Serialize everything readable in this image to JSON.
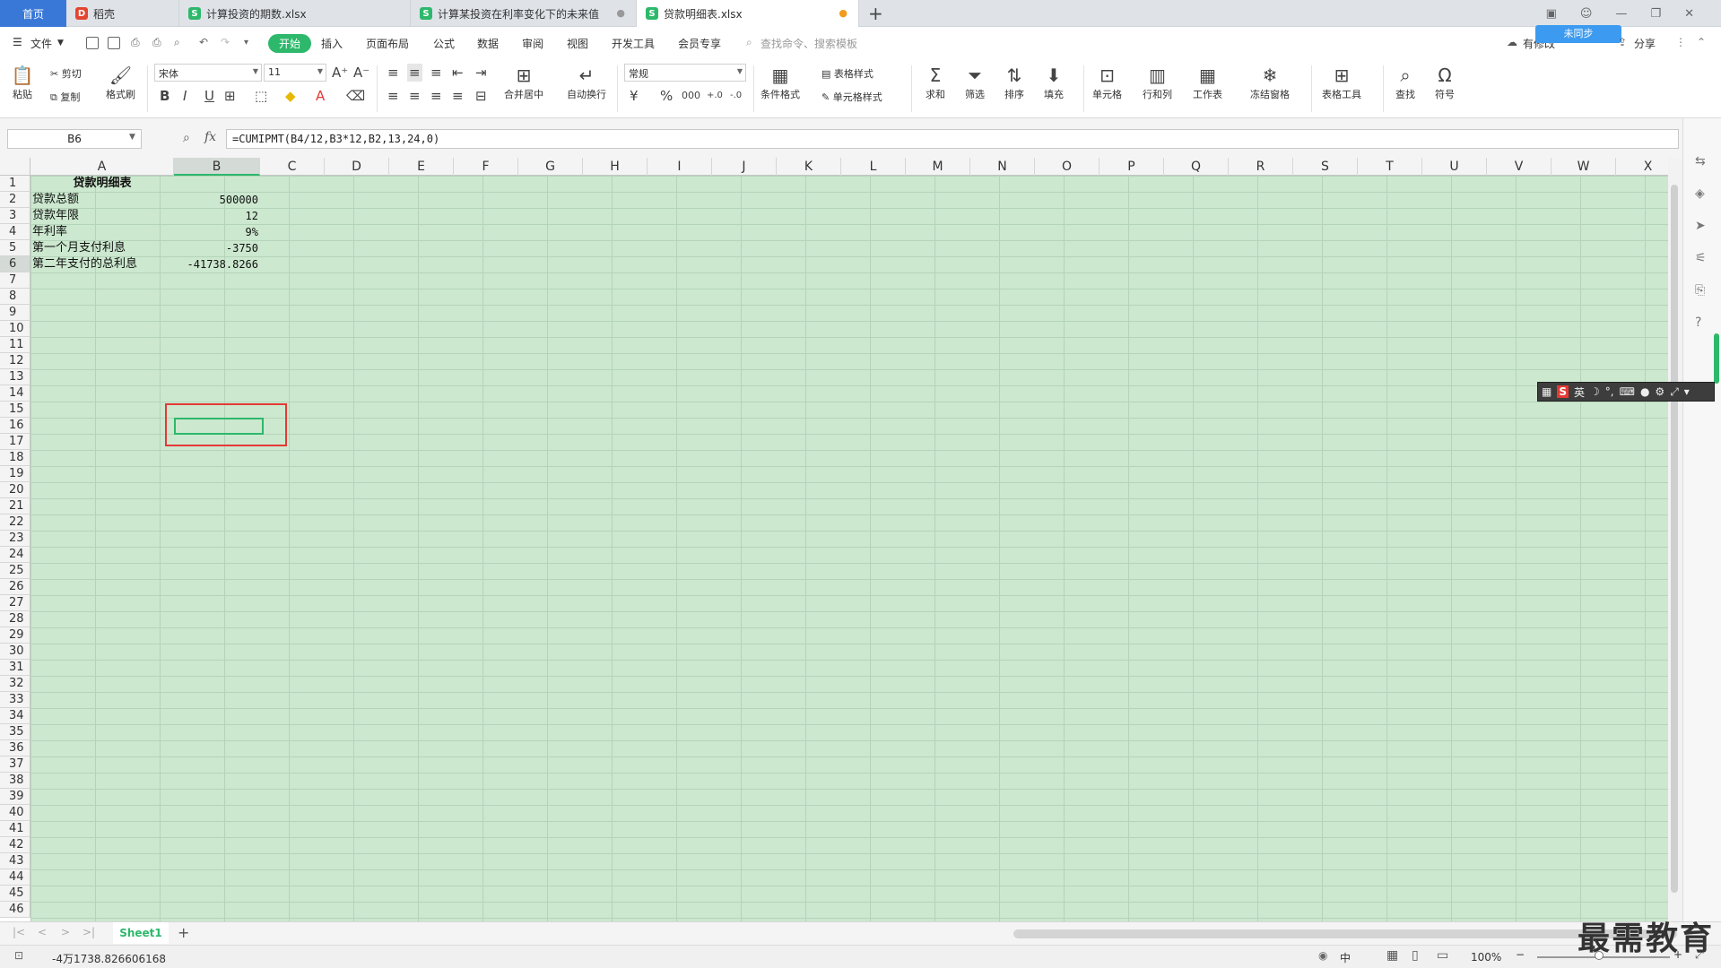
{
  "tabs": {
    "home": "首页",
    "daoke": "稻壳",
    "file1": "计算投资的期数.xlsx",
    "file2": "计算某投资在利率变化下的未来值",
    "file3": "贷款明细表.xlsx",
    "new_tab": "+"
  },
  "menu": {
    "file": "文件",
    "start": "开始",
    "insert": "插入",
    "page_layout": "页面布局",
    "formula": "公式",
    "data": "数据",
    "review": "审阅",
    "view": "视图",
    "dev_tools": "开发工具",
    "vip": "会员专享",
    "search": "查找命令、搜索模板",
    "share": "分享",
    "cloud": "有修改",
    "unsaved_badge": "未同步"
  },
  "ribbon": {
    "paste": "粘贴",
    "cut": "剪切",
    "copy": "复制",
    "format_painter": "格式刷",
    "font_name": "宋体",
    "font_size": "11",
    "merge_center": "合并居中",
    "wrap_text": "自动换行",
    "number_format": "常规",
    "cond_format": "条件格式",
    "table_style": "表格样式",
    "cell_style": "单元格样式",
    "sum": "求和",
    "filter": "筛选",
    "sort": "排序",
    "fill": "填充",
    "cells": "单元格",
    "row_col": "行和列",
    "worksheet": "工作表",
    "freeze": "冻结窗格",
    "table_tools": "表格工具",
    "find": "查找",
    "symbol": "符号"
  },
  "formula_bar": {
    "name_box": "B6",
    "fx": "fx",
    "formula": "=CUMIPMT(B4/12,B3*12,B2,13,24,0)"
  },
  "columns": [
    "A",
    "B",
    "C",
    "D",
    "E",
    "F",
    "G",
    "H",
    "I",
    "J",
    "K",
    "L",
    "M",
    "N",
    "O",
    "P",
    "Q",
    "R",
    "S",
    "T",
    "U",
    "V",
    "W",
    "X"
  ],
  "rows": [
    "1",
    "2",
    "3",
    "4",
    "5",
    "6",
    "7",
    "8",
    "9",
    "10",
    "11",
    "12",
    "13",
    "14",
    "15",
    "16",
    "17",
    "18",
    "19",
    "20",
    "21",
    "22",
    "23",
    "24",
    "25",
    "26",
    "27",
    "28",
    "29",
    "30",
    "31",
    "32",
    "33",
    "34",
    "35",
    "36",
    "37",
    "38",
    "39",
    "40",
    "41",
    "42",
    "43",
    "44",
    "45",
    "46"
  ],
  "cells": {
    "A1": "贷款明细表",
    "A2": "贷款总额",
    "B2": "500000",
    "A3": "贷款年限",
    "B3": "12",
    "A4": "年利率",
    "B4": "9%",
    "A5": "第一个月支付利息",
    "B5": "-3750",
    "A6": "第二年支付的总利息",
    "B6": "-41738.8266"
  },
  "sheet_tabs": {
    "sheet1": "Sheet1",
    "add": "+"
  },
  "status": {
    "value": "-4万1738.826606168",
    "zoom": "100%",
    "ime_lang": "中"
  },
  "watermark": "最需教育",
  "colors": {
    "accent": "#2db86b",
    "sheet_bg": "#cce8cf",
    "highlight": "#e53935",
    "home_tab": "#3a78d8"
  }
}
